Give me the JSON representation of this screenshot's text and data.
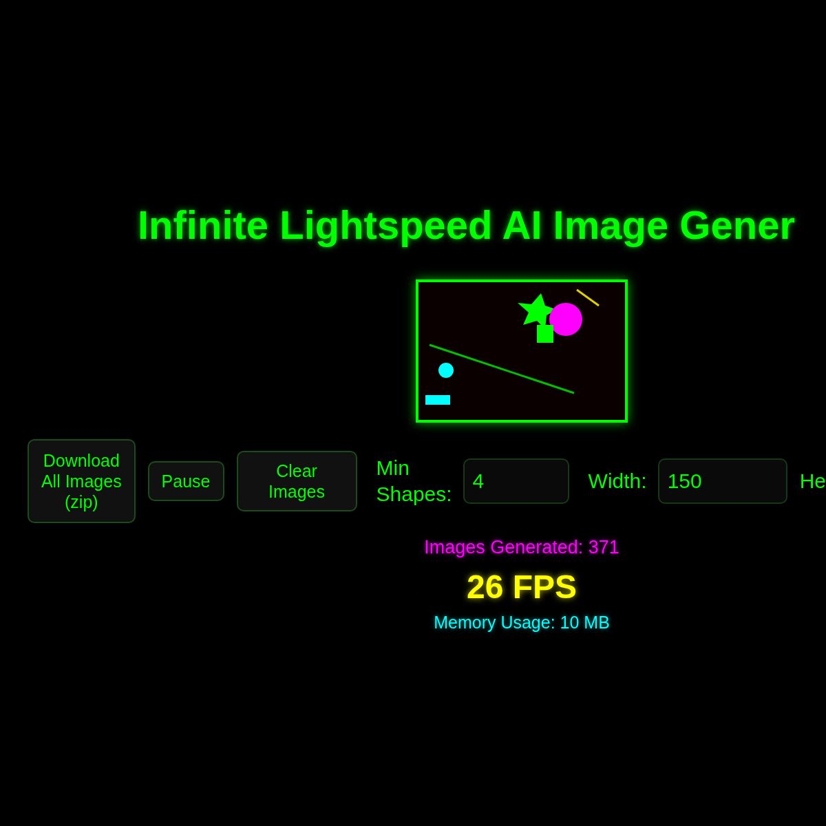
{
  "title": "Infinite Lightspeed AI Image Gener",
  "controls": [
    {
      "kind": "button",
      "label": "Download All Images (zip)"
    },
    {
      "kind": "button",
      "label": "Pause"
    },
    {
      "kind": "button",
      "label": "Clear Images"
    },
    {
      "kind": "field",
      "label": "Min Shapes:",
      "value": "4"
    },
    {
      "kind": "field",
      "label": "Width:",
      "value": "150"
    },
    {
      "kind": "label",
      "label": "He"
    }
  ],
  "stats": {
    "images_generated": "Images Generated: 371",
    "fps": "26 FPS",
    "memory": "Memory Usage: 10 MB"
  }
}
